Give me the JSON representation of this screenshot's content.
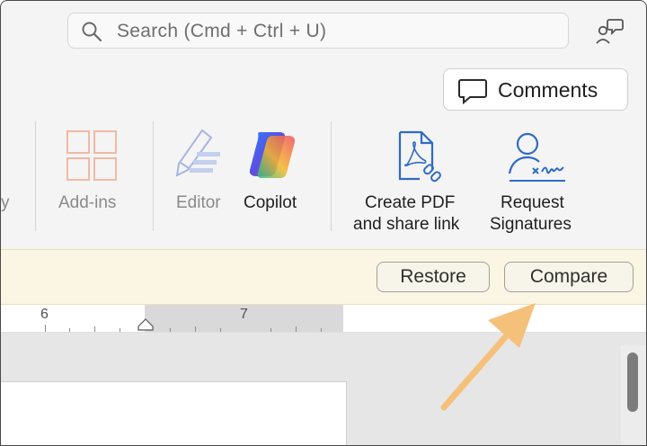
{
  "search": {
    "placeholder": "Search (Cmd + Ctrl + U)"
  },
  "header": {
    "comments_label": "Comments"
  },
  "ribbon": {
    "partial_label": "y",
    "addins_label": "Add-ins",
    "editor_label": "Editor",
    "copilot_label": "Copilot",
    "create_pdf_line1": "Create PDF",
    "create_pdf_line2": "and share link",
    "request_line1": "Request",
    "request_line2": "Signatures"
  },
  "notice": {
    "restore_label": "Restore",
    "compare_label": "Compare"
  },
  "ruler": {
    "marks": [
      "6",
      "7"
    ]
  },
  "colors": {
    "accent": "#2f6bc2",
    "highlight_arrow": "#f5c07a",
    "notice_bg": "#fbf6e3"
  },
  "icons": {
    "search": "search-icon",
    "feedback": "feedback-icon",
    "comments": "comment-bubble-icon",
    "addins": "grid-icon",
    "editor": "pen-icon",
    "copilot": "copilot-icon",
    "create_pdf": "pdf-link-icon",
    "request": "signature-icon"
  }
}
